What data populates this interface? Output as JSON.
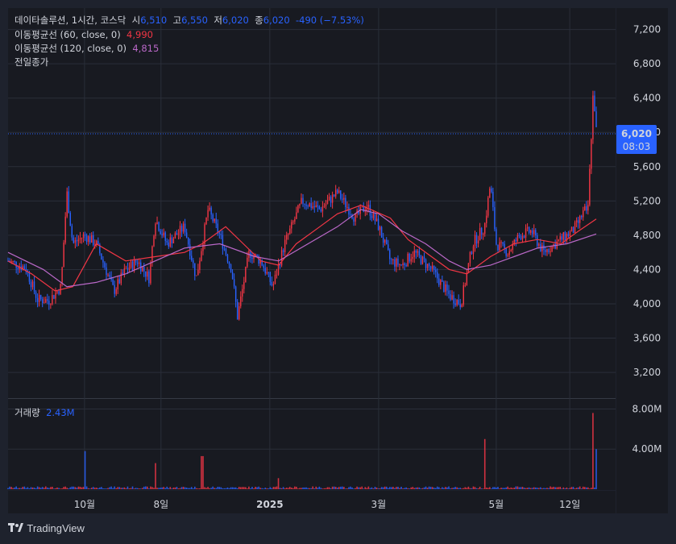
{
  "header": {
    "symbol": "데이타솔루션, 1시간, 코스닥",
    "open_label": "시",
    "open": "6,510",
    "high_label": "고",
    "high": "6,550",
    "low_label": "저",
    "low": "6,020",
    "close_label": "종",
    "close": "6,020",
    "change": "-490 (−7.53%)"
  },
  "indicators": [
    {
      "label": "이동평균선 (60, close, 0)",
      "value": "4,990",
      "color": "#f23645"
    },
    {
      "label": "이동평균선 (120, close, 0)",
      "value": "4,815",
      "color": "#ba68c8"
    },
    {
      "label": "전일종가",
      "value": "",
      "color": "#d1d4dc"
    }
  ],
  "price_tag": {
    "price": "6,020",
    "time": "08:03"
  },
  "volume_legend": {
    "label": "거래량",
    "value": "2.43M"
  },
  "colors": {
    "up": "#f23645",
    "down": "#2962ff",
    "ma60": "#f23645",
    "ma120": "#ba68c8",
    "background": "#1e222d",
    "pane": "#181a21",
    "grid": "#2a2e39",
    "tag": "#2962ff"
  },
  "brand": "TradingView",
  "chart_data": {
    "type": "candlestick",
    "price_axis": {
      "ticks": [
        "7,200",
        "6,800",
        "6,400",
        "6,000",
        "5,600",
        "5,200",
        "4,800",
        "4,400",
        "4,000",
        "3,600",
        "3,200"
      ],
      "ylim": [
        2900,
        7450
      ],
      "scale": "linear"
    },
    "volume_axis": {
      "ticks": [
        "8.00M",
        "4.00M"
      ],
      "ylim": [
        0,
        9000000
      ]
    },
    "x_ticks": [
      "10월",
      "8일",
      "2025",
      "3월",
      "5월",
      "12일"
    ],
    "grid": true,
    "price_series": [
      {
        "x": 0,
        "y": 4500
      },
      {
        "x": 0.03,
        "y": 4420
      },
      {
        "x": 0.05,
        "y": 4050
      },
      {
        "x": 0.07,
        "y": 4040
      },
      {
        "x": 0.09,
        "y": 4200
      },
      {
        "x": 0.1,
        "y": 5300
      },
      {
        "x": 0.11,
        "y": 4700
      },
      {
        "x": 0.13,
        "y": 4800
      },
      {
        "x": 0.15,
        "y": 4700
      },
      {
        "x": 0.18,
        "y": 4150
      },
      {
        "x": 0.2,
        "y": 4400
      },
      {
        "x": 0.22,
        "y": 4500
      },
      {
        "x": 0.24,
        "y": 4300
      },
      {
        "x": 0.25,
        "y": 5000
      },
      {
        "x": 0.27,
        "y": 4700
      },
      {
        "x": 0.3,
        "y": 4900
      },
      {
        "x": 0.32,
        "y": 4300
      },
      {
        "x": 0.34,
        "y": 5100
      },
      {
        "x": 0.36,
        "y": 4800
      },
      {
        "x": 0.38,
        "y": 4400
      },
      {
        "x": 0.39,
        "y": 3850
      },
      {
        "x": 0.41,
        "y": 4600
      },
      {
        "x": 0.43,
        "y": 4500
      },
      {
        "x": 0.45,
        "y": 4200
      },
      {
        "x": 0.47,
        "y": 4700
      },
      {
        "x": 0.5,
        "y": 5200
      },
      {
        "x": 0.53,
        "y": 5100
      },
      {
        "x": 0.56,
        "y": 5300
      },
      {
        "x": 0.59,
        "y": 5000
      },
      {
        "x": 0.61,
        "y": 5150
      },
      {
        "x": 0.63,
        "y": 4900
      },
      {
        "x": 0.65,
        "y": 4500
      },
      {
        "x": 0.67,
        "y": 4450
      },
      {
        "x": 0.69,
        "y": 4600
      },
      {
        "x": 0.72,
        "y": 4400
      },
      {
        "x": 0.75,
        "y": 4100
      },
      {
        "x": 0.77,
        "y": 4000
      },
      {
        "x": 0.79,
        "y": 4700
      },
      {
        "x": 0.81,
        "y": 4900
      },
      {
        "x": 0.82,
        "y": 5400
      },
      {
        "x": 0.83,
        "y": 4700
      },
      {
        "x": 0.85,
        "y": 4600
      },
      {
        "x": 0.87,
        "y": 4800
      },
      {
        "x": 0.89,
        "y": 4850
      },
      {
        "x": 0.91,
        "y": 4600
      },
      {
        "x": 0.93,
        "y": 4700
      },
      {
        "x": 0.95,
        "y": 4800
      },
      {
        "x": 0.96,
        "y": 4850
      },
      {
        "x": 0.97,
        "y": 4950
      },
      {
        "x": 0.98,
        "y": 5100
      },
      {
        "x": 0.985,
        "y": 5000
      },
      {
        "x": 0.99,
        "y": 5700
      },
      {
        "x": 0.995,
        "y": 6500
      },
      {
        "x": 1.0,
        "y": 6020
      }
    ],
    "ma60": [
      {
        "x": 0,
        "y": 4500
      },
      {
        "x": 0.04,
        "y": 4350
      },
      {
        "x": 0.08,
        "y": 4150
      },
      {
        "x": 0.11,
        "y": 4200
      },
      {
        "x": 0.15,
        "y": 4700
      },
      {
        "x": 0.2,
        "y": 4500
      },
      {
        "x": 0.25,
        "y": 4550
      },
      {
        "x": 0.3,
        "y": 4600
      },
      {
        "x": 0.33,
        "y": 4700
      },
      {
        "x": 0.37,
        "y": 4900
      },
      {
        "x": 0.4,
        "y": 4700
      },
      {
        "x": 0.43,
        "y": 4500
      },
      {
        "x": 0.46,
        "y": 4450
      },
      {
        "x": 0.49,
        "y": 4700
      },
      {
        "x": 0.53,
        "y": 4900
      },
      {
        "x": 0.56,
        "y": 5050
      },
      {
        "x": 0.6,
        "y": 5150
      },
      {
        "x": 0.65,
        "y": 5000
      },
      {
        "x": 0.68,
        "y": 4750
      },
      {
        "x": 0.72,
        "y": 4550
      },
      {
        "x": 0.75,
        "y": 4400
      },
      {
        "x": 0.78,
        "y": 4350
      },
      {
        "x": 0.82,
        "y": 4550
      },
      {
        "x": 0.86,
        "y": 4700
      },
      {
        "x": 0.9,
        "y": 4750
      },
      {
        "x": 0.94,
        "y": 4700
      },
      {
        "x": 0.97,
        "y": 4850
      },
      {
        "x": 1.0,
        "y": 4990
      }
    ],
    "ma120": [
      {
        "x": 0,
        "y": 4600
      },
      {
        "x": 0.06,
        "y": 4400
      },
      {
        "x": 0.1,
        "y": 4200
      },
      {
        "x": 0.15,
        "y": 4250
      },
      {
        "x": 0.2,
        "y": 4350
      },
      {
        "x": 0.25,
        "y": 4500
      },
      {
        "x": 0.3,
        "y": 4650
      },
      {
        "x": 0.36,
        "y": 4700
      },
      {
        "x": 0.42,
        "y": 4550
      },
      {
        "x": 0.46,
        "y": 4500
      },
      {
        "x": 0.51,
        "y": 4700
      },
      {
        "x": 0.56,
        "y": 4900
      },
      {
        "x": 0.6,
        "y": 5100
      },
      {
        "x": 0.63,
        "y": 5050
      },
      {
        "x": 0.67,
        "y": 4850
      },
      {
        "x": 0.71,
        "y": 4700
      },
      {
        "x": 0.75,
        "y": 4500
      },
      {
        "x": 0.78,
        "y": 4400
      },
      {
        "x": 0.82,
        "y": 4450
      },
      {
        "x": 0.86,
        "y": 4550
      },
      {
        "x": 0.9,
        "y": 4650
      },
      {
        "x": 0.95,
        "y": 4700
      },
      {
        "x": 1.0,
        "y": 4815
      }
    ],
    "volume_spikes": [
      {
        "x": 0.13,
        "y": 3800000
      },
      {
        "x": 0.25,
        "y": 2600000
      },
      {
        "x": 0.33,
        "y": 3300000
      },
      {
        "x": 0.46,
        "y": 1100000
      },
      {
        "x": 0.81,
        "y": 5000000
      },
      {
        "x": 0.995,
        "y": 7600000
      },
      {
        "x": 1.0,
        "y": 4000000
      }
    ]
  }
}
